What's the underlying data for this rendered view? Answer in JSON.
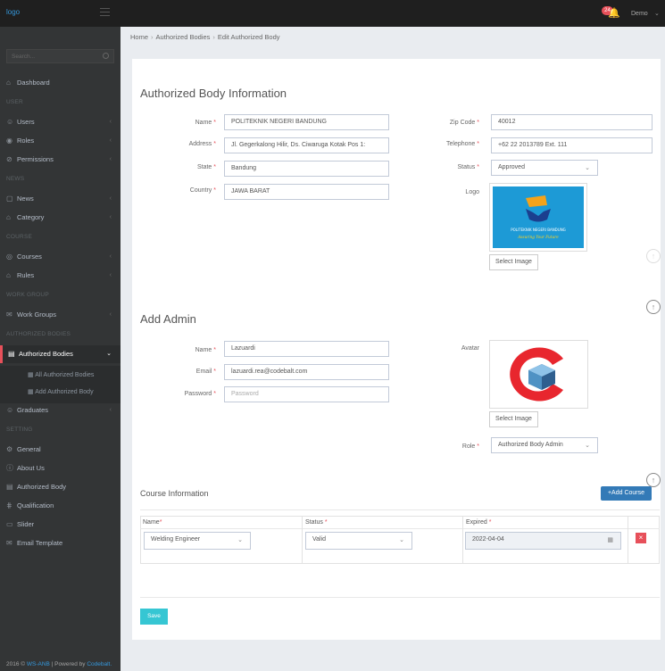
{
  "topbar": {
    "logo": "logo",
    "notif_count": "24",
    "user": "Demo"
  },
  "sidebar": {
    "search_placeholder": "Search...",
    "dashboard": "Dashboard",
    "head_user": "USER",
    "users": "Users",
    "roles": "Roles",
    "permissions": "Permissions",
    "head_news": "NEWS",
    "news": "News",
    "category": "Category",
    "head_course": "COURSE",
    "courses": "Courses",
    "rules": "Rules",
    "head_work": "WORK GROUP",
    "work_groups": "Work Groups",
    "head_auth": "AUTHORIZED BODIES",
    "authorized_bodies": "Authorized Bodies",
    "all_authorized": "All Authorized Bodies",
    "add_authorized": "Add Authorized Body",
    "graduates": "Graduates",
    "head_setting": "SETTING",
    "general": "General",
    "about": "About Us",
    "authorized_body": "Authorized Body",
    "qualification": "Qualification",
    "slider": "Slider",
    "email_template": "Email Template"
  },
  "footer": {
    "year": "2016 ©",
    "brand": "WS-ANB",
    "powered": "| Powered by",
    "company": "Codebalt."
  },
  "breadcrumb": {
    "home": "Home",
    "bodies": "Authorized Bodies",
    "current": "Edit Authorized Body"
  },
  "info": {
    "title": "Authorized Body Information",
    "name_label": "Name",
    "name_value": "POLITEKNIK NEGERI BANDUNG",
    "address_label": "Address",
    "address_value": "Jl. Gegerkalong Hilir, Ds. Ciwaruga Kotak Pos 1:",
    "state_label": "State",
    "state_value": "Bandung",
    "country_label": "Country",
    "country_value": "JAWA BARAT",
    "zip_label": "Zip Code",
    "zip_value": "40012",
    "phone_label": "Telephone",
    "phone_value": "+62 22 2013789 Ext. 111",
    "status_label": "Status",
    "status_value": "Approved",
    "logo_label": "Logo",
    "logo_text": "POLITEKNIK NEGERI BANDUNG",
    "logo_tagline": "Assuring Your Future",
    "select_image": "Select Image"
  },
  "admin": {
    "title": "Add Admin",
    "name_label": "Name",
    "name_value": "Lazuardi",
    "email_label": "Email",
    "email_value": "lazuardi.rea@codebalt.com",
    "password_label": "Password",
    "password_placeholder": "Password",
    "avatar_label": "Avatar",
    "select_image": "Select Image",
    "role_label": "Role",
    "role_value": "Authorized Body Admin"
  },
  "course": {
    "title": "Course Information",
    "add_button": "+Add Course",
    "col_name": "Name",
    "col_status": "Status",
    "col_expired": "Expired",
    "row_name": "Welding Engineer",
    "row_status": "Valid",
    "row_expired": "2022-04-04",
    "delete": "×"
  },
  "save": "Save"
}
